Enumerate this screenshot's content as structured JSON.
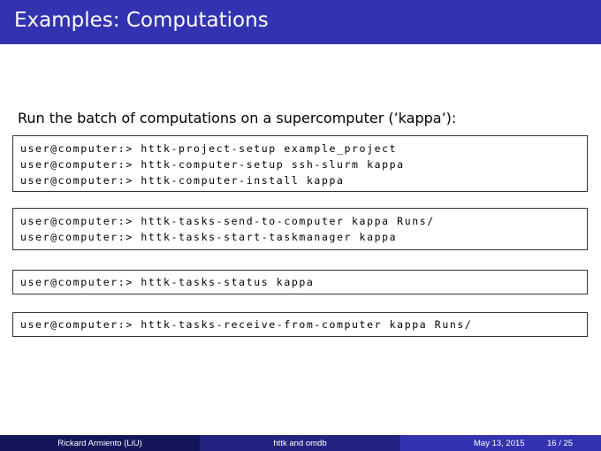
{
  "slide": {
    "title": "Examples: Computations",
    "intro": "Run the batch of computations on a supercomputer (’kappa’):"
  },
  "code_blocks": [
    {
      "lines": [
        "user@computer:> httk-project-setup example_project",
        "user@computer:> httk-computer-setup ssh-slurm kappa",
        "user@computer:> httk-computer-install kappa"
      ]
    },
    {
      "lines": [
        "user@computer:> httk-tasks-send-to-computer kappa Runs/",
        "user@computer:> httk-tasks-start-taskmanager kappa"
      ]
    },
    {
      "lines": [
        "user@computer:> httk-tasks-status kappa"
      ]
    },
    {
      "lines": [
        "user@computer:> httk-tasks-receive-from-computer kappa Runs/"
      ]
    }
  ],
  "footer": {
    "author": "Rickard Armiento  (LiU)",
    "short_title": "httk and omdb",
    "date": "May 13, 2015",
    "page": "16 / 25"
  },
  "colors": {
    "title_bar": "#3333b2",
    "footer_dark": "#15155a",
    "footer_mid": "#232382",
    "footer_light": "#3333b2"
  }
}
